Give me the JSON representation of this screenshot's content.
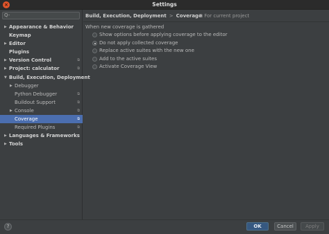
{
  "window": {
    "title": "Settings"
  },
  "search": {
    "placeholder": "Q-"
  },
  "tree": [
    {
      "label": "Appearance & Behavior",
      "level": 0,
      "arrow": "▶",
      "bold": true,
      "copy": false,
      "selected": false
    },
    {
      "label": "Keymap",
      "level": 0,
      "arrow": "",
      "bold": true,
      "copy": false,
      "selected": false
    },
    {
      "label": "Editor",
      "level": 0,
      "arrow": "▶",
      "bold": true,
      "copy": false,
      "selected": false
    },
    {
      "label": "Plugins",
      "level": 0,
      "arrow": "",
      "bold": true,
      "copy": false,
      "selected": false
    },
    {
      "label": "Version Control",
      "level": 0,
      "arrow": "▶",
      "bold": true,
      "copy": true,
      "selected": false
    },
    {
      "label": "Project: calculator",
      "level": 0,
      "arrow": "▶",
      "bold": true,
      "copy": true,
      "selected": false
    },
    {
      "label": "Build, Execution, Deployment",
      "level": 0,
      "arrow": "▼",
      "bold": true,
      "copy": false,
      "selected": false
    },
    {
      "label": "Debugger",
      "level": 1,
      "arrow": "▶",
      "bold": false,
      "copy": false,
      "selected": false
    },
    {
      "label": "Python Debugger",
      "level": 1,
      "arrow": "",
      "bold": false,
      "copy": true,
      "selected": false
    },
    {
      "label": "Buildout Support",
      "level": 1,
      "arrow": "",
      "bold": false,
      "copy": true,
      "selected": false
    },
    {
      "label": "Console",
      "level": 1,
      "arrow": "▶",
      "bold": false,
      "copy": true,
      "selected": false
    },
    {
      "label": "Coverage",
      "level": 1,
      "arrow": "",
      "bold": false,
      "copy": true,
      "selected": true
    },
    {
      "label": "Required Plugins",
      "level": 1,
      "arrow": "",
      "bold": false,
      "copy": true,
      "selected": false
    },
    {
      "label": "Languages & Frameworks",
      "level": 0,
      "arrow": "▶",
      "bold": true,
      "copy": false,
      "selected": false
    },
    {
      "label": "Tools",
      "level": 0,
      "arrow": "▶",
      "bold": true,
      "copy": false,
      "selected": false
    }
  ],
  "breadcrumb": {
    "parent": "Build, Execution, Deployment",
    "separator": ">",
    "current": "Coverage"
  },
  "scope": {
    "icon": "copy-icon",
    "text": "For current project"
  },
  "coverage": {
    "group_label": "When new coverage is gathered",
    "options": [
      {
        "label": "Show options before applying coverage to the editor",
        "checked": false
      },
      {
        "label": "Do not apply collected coverage",
        "checked": true
      },
      {
        "label": "Replace active suites with the new one",
        "checked": false
      },
      {
        "label": "Add to the active suites",
        "checked": false
      }
    ],
    "activate_view_label": "Activate Coverage View",
    "activate_view_checked": false
  },
  "footer": {
    "help_label": "?",
    "ok_label": "OK",
    "cancel_label": "Cancel",
    "apply_label": "Apply"
  },
  "colors": {
    "selection": "#4b6eaf",
    "ok_button": "#365880",
    "background": "#3c3f41"
  }
}
